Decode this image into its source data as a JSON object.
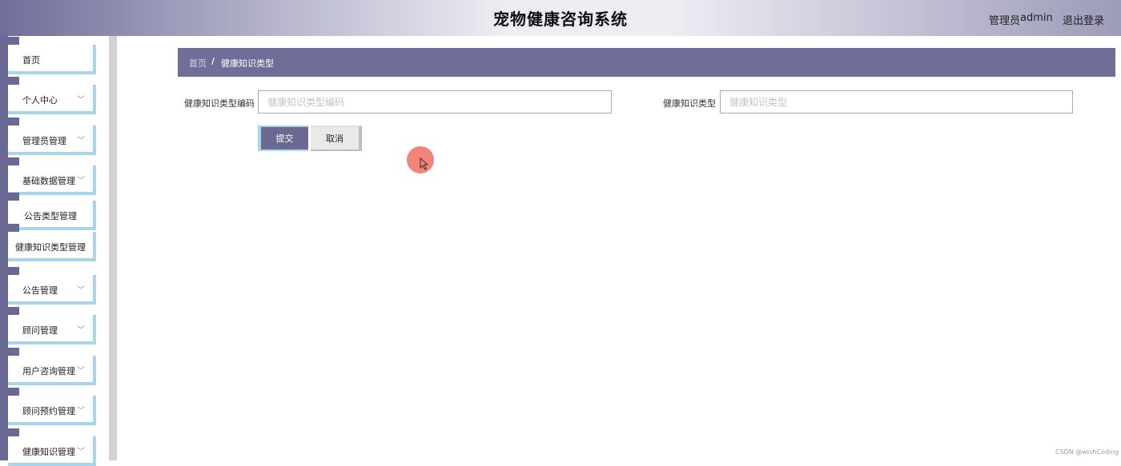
{
  "header": {
    "title": "宠物健康咨询系统",
    "user_label": "管理员",
    "user_name": "admin",
    "logout_label": "退出登录"
  },
  "sidebar": {
    "items": [
      {
        "label": "首页",
        "has_chevron": false
      },
      {
        "label": "个人中心",
        "has_chevron": true
      },
      {
        "label": "管理员管理",
        "has_chevron": true
      },
      {
        "label": "基础数据管理",
        "has_chevron": true
      },
      {
        "label": "公告类型管理",
        "has_chevron": false
      },
      {
        "label": "健康知识类型管理",
        "has_chevron": false
      },
      {
        "label": "公告管理",
        "has_chevron": true
      },
      {
        "label": "顾问管理",
        "has_chevron": true
      },
      {
        "label": "用户咨询管理",
        "has_chevron": true
      },
      {
        "label": "顾问预约管理",
        "has_chevron": true
      },
      {
        "label": "健康知识管理",
        "has_chevron": true
      }
    ],
    "chevron_glyph": "﹀"
  },
  "breadcrumb": {
    "home": "首页",
    "separator": "/",
    "current": "健康知识类型"
  },
  "form": {
    "code_label": "健康知识类型编码",
    "code_placeholder": "健康知识类型编码",
    "code_value": "",
    "type_label": "健康知识类型",
    "type_placeholder": "健康知识类型",
    "type_value": "",
    "submit_label": "提交",
    "cancel_label": "取消"
  },
  "watermark": "CSDN @wishCoding",
  "colors": {
    "accent": "#6a6993",
    "nav_border": "#a8d5ea",
    "cursor_highlight": "#f06e64"
  }
}
